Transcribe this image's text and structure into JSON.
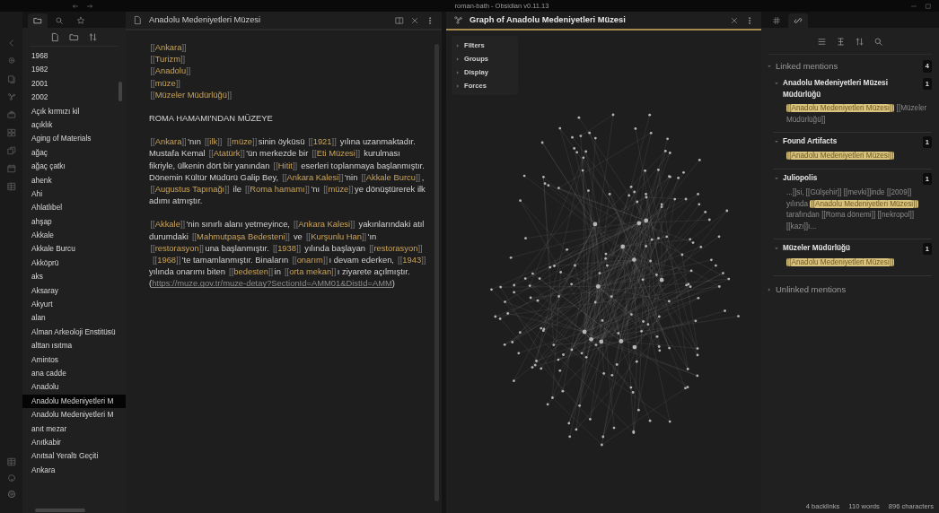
{
  "window": {
    "title": "roman-bath - Obsidian v0.11.13"
  },
  "left_sidebar": {
    "tabs": [
      {
        "kind": "files",
        "selected": true
      },
      {
        "kind": "search",
        "selected": false
      },
      {
        "kind": "starred",
        "selected": false
      }
    ],
    "files": [
      {
        "name": "1968",
        "selected": false
      },
      {
        "name": "1982",
        "selected": false
      },
      {
        "name": "2001",
        "selected": false
      },
      {
        "name": "2002",
        "selected": false
      },
      {
        "name": "Açık kırmızı kil",
        "selected": false
      },
      {
        "name": "açıklık",
        "selected": false
      },
      {
        "name": "Aging of Materials",
        "selected": false
      },
      {
        "name": "ağaç",
        "selected": false
      },
      {
        "name": "ağaç çatkı",
        "selected": false
      },
      {
        "name": "ahenk",
        "selected": false
      },
      {
        "name": "Ahi",
        "selected": false
      },
      {
        "name": "Ahlatlıbel",
        "selected": false
      },
      {
        "name": "ahşap",
        "selected": false
      },
      {
        "name": "Akkale",
        "selected": false
      },
      {
        "name": "Akkale Burcu",
        "selected": false
      },
      {
        "name": "Akköprü",
        "selected": false
      },
      {
        "name": "aks",
        "selected": false
      },
      {
        "name": "Aksaray",
        "selected": false
      },
      {
        "name": "Akyurt",
        "selected": false
      },
      {
        "name": "alan",
        "selected": false
      },
      {
        "name": "Alman Arkeoloji Enstitüsü",
        "selected": false
      },
      {
        "name": "alttan ısıtma",
        "selected": false
      },
      {
        "name": "Amintos",
        "selected": false
      },
      {
        "name": "ana cadde",
        "selected": false
      },
      {
        "name": "Anadolu",
        "selected": false
      },
      {
        "name": "Anadolu Medeniyetleri M",
        "selected": true
      },
      {
        "name": "Anadolu Medeniyetleri M",
        "selected": false
      },
      {
        "name": "anıt mezar",
        "selected": false
      },
      {
        "name": "Anıtkabir",
        "selected": false
      },
      {
        "name": "Anıtsal Yeraltı Geçiti",
        "selected": false
      },
      {
        "name": "Ankara",
        "selected": false
      }
    ]
  },
  "editor": {
    "title": "Anadolu Medeniyetleri Müzesi",
    "active": false,
    "blocks": [
      {
        "kind": "line",
        "segments": [
          {
            "kind": "link",
            "open": "[[",
            "text": "Ankara",
            "close": "]]"
          }
        ]
      },
      {
        "kind": "line",
        "segments": [
          {
            "kind": "link",
            "open": "[[",
            "text": "Turizm",
            "close": "]]"
          }
        ]
      },
      {
        "kind": "line",
        "segments": [
          {
            "kind": "link",
            "open": "[[",
            "text": "Anadolu",
            "close": "]]"
          }
        ]
      },
      {
        "kind": "line",
        "segments": [
          {
            "kind": "link",
            "open": "[[",
            "text": "müze",
            "close": "]]"
          }
        ]
      },
      {
        "kind": "para",
        "segments": [
          {
            "kind": "link",
            "open": "[[",
            "text": "Müzeler Müdürlüğü",
            "close": "]]"
          }
        ]
      },
      {
        "kind": "para",
        "segments": [
          {
            "kind": "plain",
            "text": "ROMA HAMAMI'NDAN MÜZEYE"
          }
        ]
      },
      {
        "kind": "para",
        "segments": [
          {
            "kind": "link",
            "open": "[[",
            "text": "Ankara",
            "close": "]]"
          },
          {
            "kind": "plain",
            "text": "'nın "
          },
          {
            "kind": "link",
            "open": "[[",
            "text": "ilk",
            "close": "]]"
          },
          {
            "kind": "link",
            "open": "[[",
            "text": "müze",
            "close": "]]",
            "gap": true
          },
          {
            "kind": "plain",
            "text": "sinin öyküsü "
          },
          {
            "kind": "link",
            "open": "[[",
            "text": "1921",
            "close": "]]"
          },
          {
            "kind": "plain",
            "text": " yılına uzanmaktadır. Mustafa Kemal "
          },
          {
            "kind": "link",
            "open": "[[",
            "text": "Atatürk",
            "close": "]]"
          },
          {
            "kind": "plain",
            "text": "'ün merkezde bir "
          },
          {
            "kind": "link",
            "open": "[[",
            "text": "Eti Müzesi",
            "close": "]]"
          },
          {
            "kind": "plain",
            "text": " kurulması fikriyle, ülkenin dört bir yanından "
          },
          {
            "kind": "link",
            "open": "[[",
            "text": "Hitit",
            "close": "]]"
          },
          {
            "kind": "plain",
            "text": " eserleri toplanmaya başlanmıştır. Dönemin Kültür Müdürü Galip Bey, "
          },
          {
            "kind": "link",
            "open": "[[",
            "text": "Ankara Kalesi",
            "close": "]]"
          },
          {
            "kind": "plain",
            "text": "'nin "
          },
          {
            "kind": "link",
            "open": "[[",
            "text": "Akkale Burcu",
            "close": "]]"
          },
          {
            "kind": "plain",
            "text": ", "
          },
          {
            "kind": "link",
            "open": "[[",
            "text": "Augustus Tapınağı",
            "close": "]]"
          },
          {
            "kind": "plain",
            "text": " ile "
          },
          {
            "kind": "link",
            "open": "[[",
            "text": "Roma hamamı",
            "close": "]]"
          },
          {
            "kind": "plain",
            "text": "'nı "
          },
          {
            "kind": "link",
            "open": "[[",
            "text": "müze",
            "close": "]]"
          },
          {
            "kind": "plain",
            "text": "ye dönüştürerek ilk adımı atmıştır."
          }
        ]
      },
      {
        "kind": "para",
        "segments": [
          {
            "kind": "link",
            "open": "[[",
            "text": "Akkale",
            "close": "]]"
          },
          {
            "kind": "plain",
            "text": "'nin sınırlı alanı yetmeyince, "
          },
          {
            "kind": "link",
            "open": "[[",
            "text": "Ankara Kalesi",
            "close": "]]"
          },
          {
            "kind": "plain",
            "text": " yakınlarındaki atıl durumdaki "
          },
          {
            "kind": "link",
            "open": "[[",
            "text": "Mahmutpaşa Bedesteni",
            "close": "]]"
          },
          {
            "kind": "plain",
            "text": " ve "
          },
          {
            "kind": "link",
            "open": "[[",
            "text": "Kurşunlu Han",
            "close": "]]"
          },
          {
            "kind": "plain",
            "text": "'ın "
          },
          {
            "kind": "link",
            "open": "[[",
            "text": "restorasyon",
            "close": "]]"
          },
          {
            "kind": "plain",
            "text": "una başlanmıştır. "
          },
          {
            "kind": "link",
            "open": "[[",
            "text": "1938",
            "close": "]]"
          },
          {
            "kind": "plain",
            "text": " yılında başlayan "
          },
          {
            "kind": "link",
            "open": "[[",
            "text": "restorasyon",
            "close": "]]"
          },
          {
            "kind": "link",
            "open": "[[",
            "text": "1968",
            "close": "]]",
            "gap": true
          },
          {
            "kind": "plain",
            "text": "'te tamamlanmıştır. Binaların "
          },
          {
            "kind": "link",
            "open": "[[",
            "text": "onarım",
            "close": "]]"
          },
          {
            "kind": "plain",
            "text": "ı devam ederken, "
          },
          {
            "kind": "link",
            "open": "[[",
            "text": "1943",
            "close": "]]"
          },
          {
            "kind": "plain",
            "text": " yılında onarımı biten "
          },
          {
            "kind": "link",
            "open": "[[",
            "text": "bedesten",
            "close": "]]"
          },
          {
            "kind": "plain",
            "text": "in "
          },
          {
            "kind": "link",
            "open": "[[",
            "text": "orta mekan",
            "close": "]]"
          },
          {
            "kind": "plain",
            "text": "ı ziyarete açılmıştır. ("
          },
          {
            "kind": "url",
            "text": "https://muze.gov.tr/muze-detay?SectionId=AMM01&DistId=AMM"
          },
          {
            "kind": "plain",
            "text": ")"
          }
        ]
      }
    ]
  },
  "graph": {
    "title": "Graph of Anadolu Medeniyetleri Müzesi",
    "active": true,
    "controls": [
      {
        "label": "Filters",
        "expanded": false
      },
      {
        "label": "Groups",
        "expanded": false
      },
      {
        "label": "Display",
        "expanded": false
      },
      {
        "label": "Forces",
        "expanded": false
      }
    ]
  },
  "right_sidebar": {
    "tabs": [
      {
        "kind": "tags",
        "selected": false
      },
      {
        "kind": "backlinks",
        "selected": true
      }
    ],
    "linked": {
      "label": "Linked mentions",
      "count": "4",
      "expanded": true,
      "groups": [
        {
          "title": "Anadolu Medeniyetleri Müzesi Müdürlüğü",
          "count": "1",
          "expanded": true,
          "context": [
            {
              "text": "[[Anadolu Medeniyetleri Müzesi]]",
              "highlight": true
            },
            {
              "text": " [[Müzeler Müdürlüğü]]",
              "highlight": false
            }
          ]
        },
        {
          "title": "Found Artifacts",
          "count": "1",
          "expanded": true,
          "context": [
            {
              "text": "[[Anadolu Medeniyetleri Müzesi]]",
              "highlight": true
            }
          ]
        },
        {
          "title": "Juliopolis",
          "count": "1",
          "expanded": true,
          "context": [
            {
              "text": "...]]si, [[Gülşehir]] [[mevki]]inde [[2009]] yılında ",
              "highlight": false
            },
            {
              "text": "[[Anadolu Medeniyetleri Müzesi]]",
              "highlight": true
            },
            {
              "text": " tarafından [[Roma dönemi]] [[nekropol]] [[kazı]]ı...",
              "highlight": false
            }
          ]
        },
        {
          "title": "Müzeler Müdürlüğü",
          "count": "1",
          "expanded": true,
          "context": [
            {
              "text": "[[Anadolu Medeniyetleri Müzesi]]",
              "highlight": true
            }
          ]
        }
      ]
    },
    "unlinked": {
      "label": "Unlinked mentions",
      "expanded": false
    }
  },
  "status_bar": [
    "4 backlinks",
    "110 words",
    "896 characters"
  ]
}
